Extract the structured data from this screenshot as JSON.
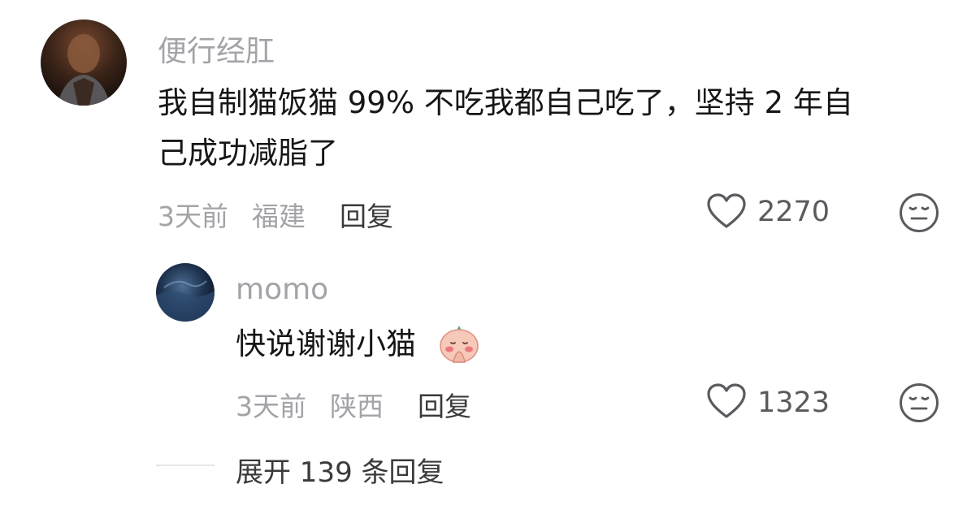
{
  "comment": {
    "username": "便行经肛",
    "text_line1": "我自制猫饭猫 99% 不吃我都自己吃了，坚持 2 年自",
    "text_line2": "己成功减脂了",
    "time": "3天前",
    "location": "福建",
    "reply_label": "回复",
    "likes": "2270",
    "icons": [
      "avatar",
      "heart-icon",
      "dislike-face-icon"
    ]
  },
  "reply": {
    "username": "momo",
    "text": "快说谢谢小猫",
    "emoji": "praying-peach-emoji",
    "time": "3天前",
    "location": "陕西",
    "reply_label": "回复",
    "likes": "1323",
    "icons": [
      "avatar",
      "heart-icon",
      "dislike-face-icon"
    ]
  },
  "expand_label": "展开 139 条回复",
  "colors": {
    "secondary_text": "#a3a3a8",
    "primary_text": "#161616",
    "icon": "#5a5a5f"
  }
}
